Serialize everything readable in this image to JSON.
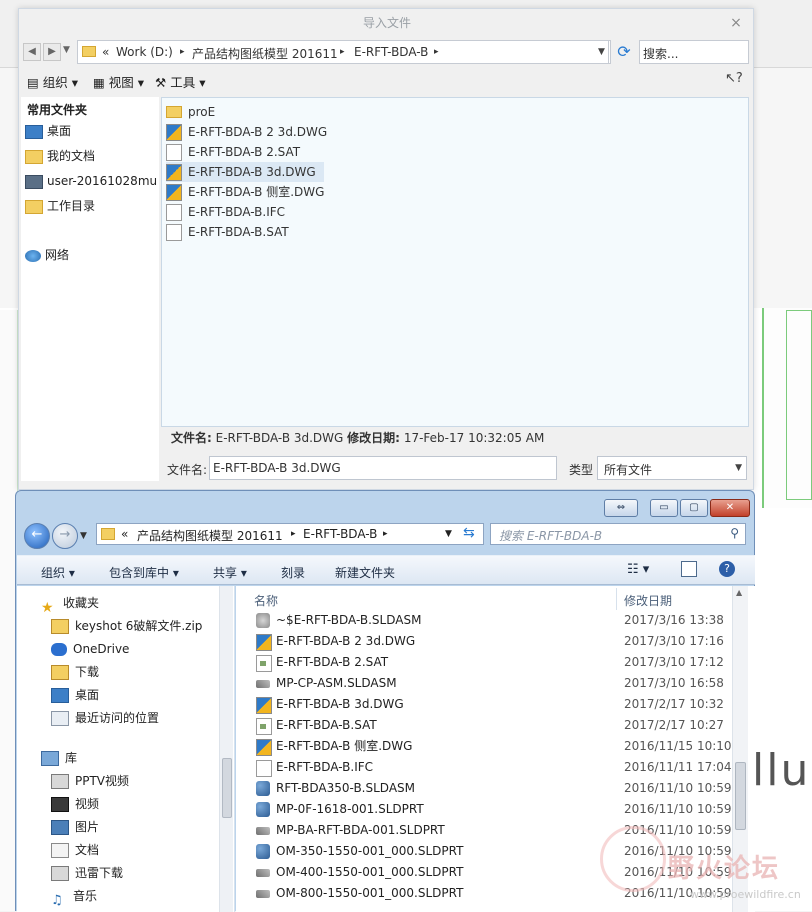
{
  "import_dialog": {
    "title": "导入文件",
    "close": "×",
    "address": {
      "prefix": "«",
      "segments": [
        "Work (D:)",
        "产品结构图纸模型 201611",
        "E-RFT-BDA-B"
      ],
      "sep": "▸"
    },
    "search_placeholder": "搜索...",
    "toolbar": {
      "organize": "组织",
      "views": "视图",
      "tools": "工具",
      "help": "?"
    },
    "left_pane": {
      "heading": "常用文件夹",
      "items": [
        "桌面",
        "我的文档",
        "user-20161028mu",
        "工作目录",
        "网络"
      ]
    },
    "files": [
      {
        "name": "proE",
        "type": "folder"
      },
      {
        "name": "E-RFT-BDA-B 2 3d.DWG",
        "type": "dwg"
      },
      {
        "name": "E-RFT-BDA-B 2.SAT",
        "type": "doc"
      },
      {
        "name": "E-RFT-BDA-B 3d.DWG",
        "type": "dwg",
        "selected": true
      },
      {
        "name": "E-RFT-BDA-B 侧室.DWG",
        "type": "dwg"
      },
      {
        "name": "E-RFT-BDA-B.IFC",
        "type": "doc"
      },
      {
        "name": "E-RFT-BDA-B.SAT",
        "type": "doc"
      }
    ],
    "info": {
      "filename_label": "文件名:",
      "filename": "E-RFT-BDA-B 3d.DWG",
      "modified_label": "修改日期:",
      "modified": "17-Feb-17 10:32:05 AM"
    },
    "filename_field_label": "文件名:",
    "filename_value": "E-RFT-BDA-B 3d.DWG",
    "type_label": "类型",
    "type_value": "所有文件"
  },
  "explorer": {
    "address": {
      "prefix": "«",
      "segments": [
        "产品结构图纸模型 201611",
        "E-RFT-BDA-B"
      ],
      "sep": "▸"
    },
    "search_placeholder": "搜索 E-RFT-BDA-B",
    "commands": [
      "组织 ▾",
      "包含到库中 ▾",
      "共享 ▾",
      "刻录",
      "新建文件夹"
    ],
    "nav": {
      "favorites_label": "收藏夹",
      "favorites": [
        "keyshot 6破解文件.zip",
        "OneDrive",
        "下载",
        "桌面",
        "最近访问的位置"
      ],
      "library_label": "库",
      "library": [
        "PPTV视频",
        "视频",
        "图片",
        "文档",
        "迅雷下载",
        "音乐"
      ]
    },
    "columns": {
      "name": "名称",
      "date": "修改日期"
    },
    "rows": [
      {
        "name": "~$E-RFT-BDA-B.SLDASM",
        "date": "2017/3/16 13:38",
        "icon": "asm"
      },
      {
        "name": "E-RFT-BDA-B 2 3d.DWG",
        "date": "2017/3/10 17:16",
        "icon": "dwg"
      },
      {
        "name": "E-RFT-BDA-B 2.SAT",
        "date": "2017/3/10 17:12",
        "icon": "sat"
      },
      {
        "name": "MP-CP-ASM.SLDASM",
        "date": "2017/3/10 16:58",
        "icon": "prt2"
      },
      {
        "name": "E-RFT-BDA-B 3d.DWG",
        "date": "2017/2/17 10:32",
        "icon": "dwg"
      },
      {
        "name": "E-RFT-BDA-B.SAT",
        "date": "2017/2/17 10:27",
        "icon": "sat"
      },
      {
        "name": "E-RFT-BDA-B 侧室.DWG",
        "date": "2016/11/15 10:10",
        "icon": "dwg"
      },
      {
        "name": "E-RFT-BDA-B.IFC",
        "date": "2016/11/11 17:04",
        "icon": "doc"
      },
      {
        "name": "RFT-BDA350-B.SLDASM",
        "date": "2016/11/10 10:59",
        "icon": "prt"
      },
      {
        "name": "MP-0F-1618-001.SLDPRT",
        "date": "2016/11/10 10:59",
        "icon": "prt"
      },
      {
        "name": "MP-BA-RFT-BDA-001.SLDPRT",
        "date": "2016/11/10 10:59",
        "icon": "prt2"
      },
      {
        "name": "OM-350-1550-001_000.SLDPRT",
        "date": "2016/11/10 10:59",
        "icon": "prt"
      },
      {
        "name": "OM-400-1550-001_000.SLDPRT",
        "date": "2016/11/10 10:59",
        "icon": "prt2"
      },
      {
        "name": "OM-800-1550-001_000.SLDPRT",
        "date": "2016/11/10 10:59",
        "icon": "prt2"
      }
    ]
  },
  "background": {
    "partial_text": "llu"
  },
  "watermark": {
    "text": "野火论坛",
    "url": "www.proewildfire.cn"
  },
  "colors": {
    "accent": "#2a7bd1",
    "selection": "#dbe8f4",
    "explorer_frame": "#bcd4ec"
  }
}
